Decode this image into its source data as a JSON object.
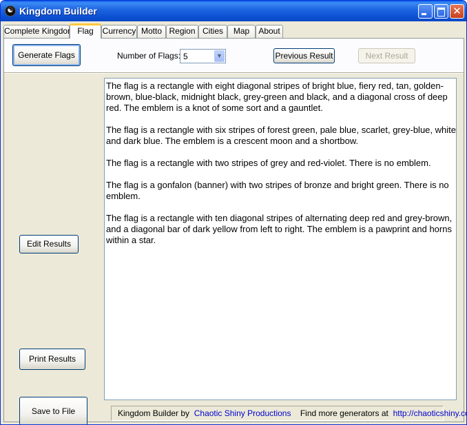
{
  "window": {
    "title": "Kingdom Builder",
    "icon": "app-logo-icon",
    "controls": [
      "minimize-icon",
      "maximize-icon",
      "close-icon"
    ]
  },
  "tabs": [
    {
      "label": "Complete Kingdom",
      "active": false
    },
    {
      "label": "Flag",
      "active": true
    },
    {
      "label": "Currency",
      "active": false
    },
    {
      "label": "Motto",
      "active": false
    },
    {
      "label": "Region",
      "active": false
    },
    {
      "label": "Cities",
      "active": false
    },
    {
      "label": "Map",
      "active": false
    },
    {
      "label": "About",
      "active": false
    }
  ],
  "toolbar": {
    "generate_label": "Generate Flags",
    "count_label": "Number of Flags:",
    "count_value": "5",
    "previous_label": "Previous Result",
    "next_label": "Next Result",
    "next_enabled": false
  },
  "side_buttons": {
    "edit_label": "Edit Results",
    "print_label": "Print Results",
    "save_label": "Save to File"
  },
  "results": [
    "The flag is a rectangle  with eight diagonal stripes of bright blue, fiery red, tan, golden-brown, blue-black, midnight black, grey-green and black,  and a diagonal cross of deep red. The emblem is a knot of some sort and a gauntlet.",
    "The flag is a rectangle  with six stripes of forest green, pale blue, scarlet, grey-blue, white and dark blue. The emblem is a crescent moon and a shortbow.",
    "The flag is a rectangle  with two stripes of grey and red-violet. There is no emblem.",
    "The flag is a gonfalon (banner)  with two stripes of bronze and bright green. There is no emblem.",
    "The flag is a rectangle  with ten diagonal stripes of alternating deep red and grey-brown,  and a diagonal bar of dark yellow from left to right. The emblem is a pawprint and horns within a star."
  ],
  "footer": {
    "prefix": "Kingdom Builder by",
    "author_link": "Chaotic Shiny Productions",
    "more_text": "Find more generators at",
    "site_link": "http://chaoticshiny.com/"
  },
  "colors": {
    "titlebar": "#0b4fd1",
    "window_bg": "#ece9d8",
    "link": "#0000cc",
    "active_tab_accent": "#ffc83c"
  }
}
